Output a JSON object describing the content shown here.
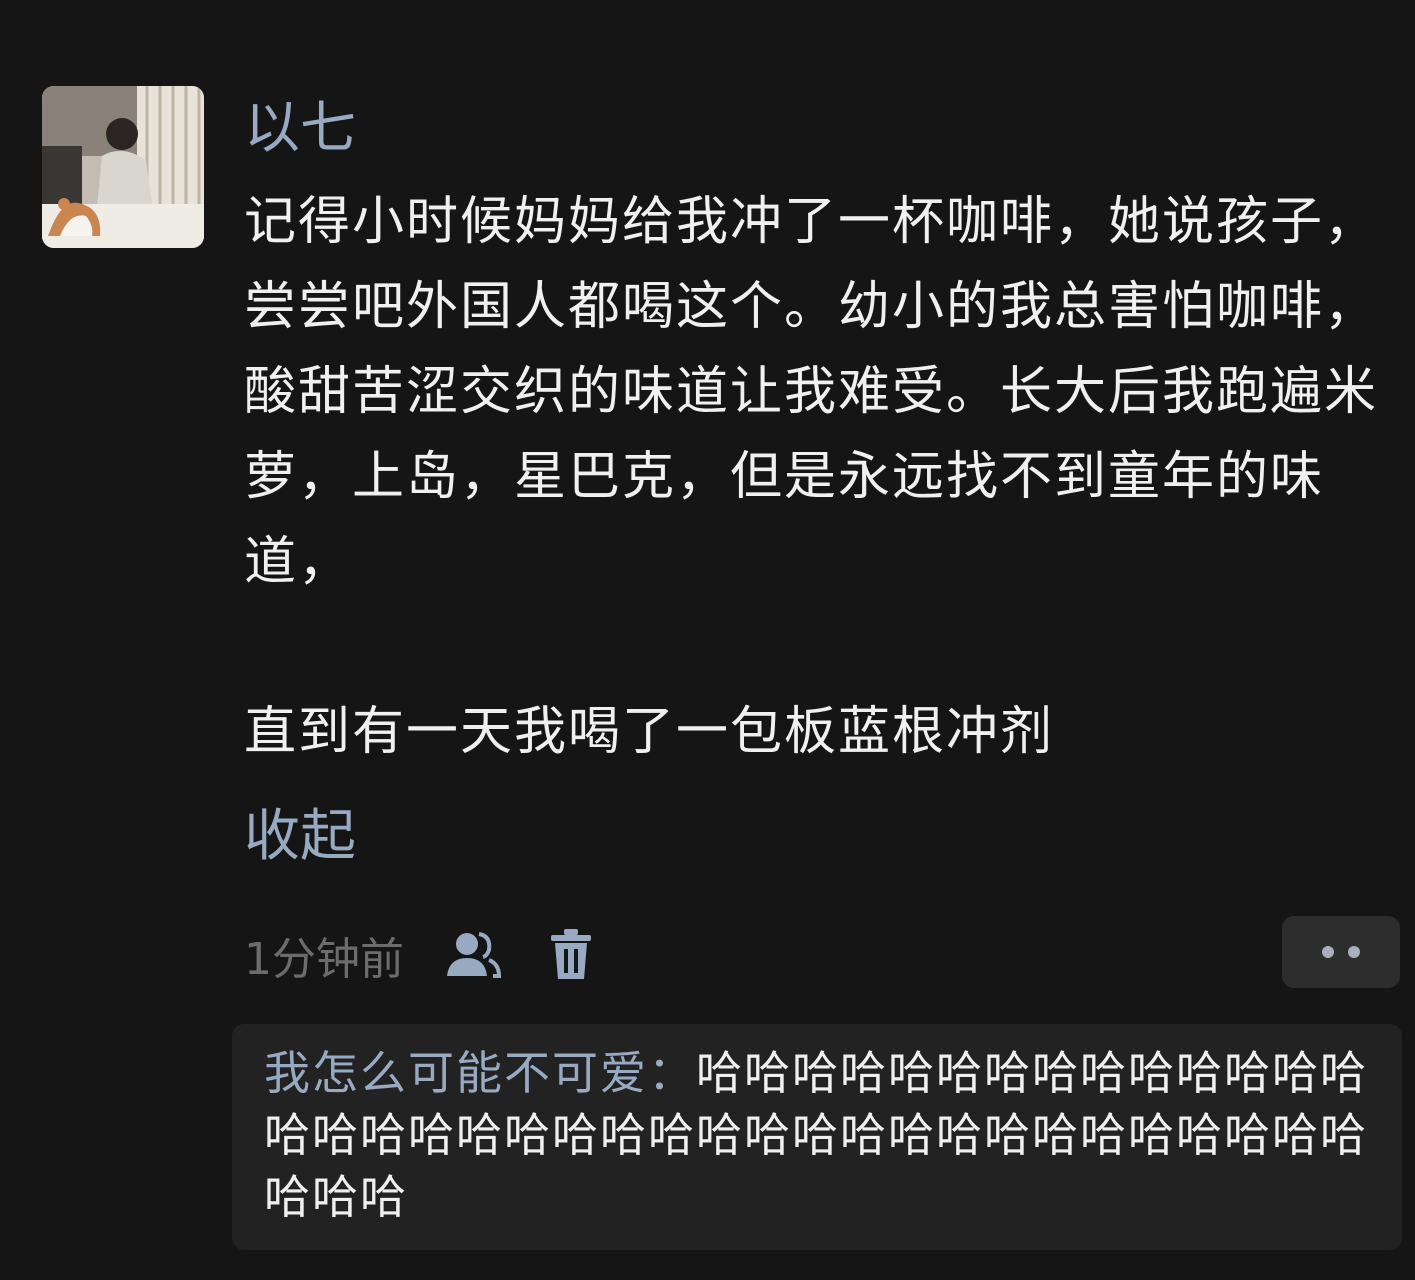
{
  "comment": {
    "author": "以七",
    "paragraphs": [
      "记得小时候妈妈给我冲了一杯咖啡，她说孩子，尝尝吧外国人都喝这个。幼小的我总害怕咖啡，酸甜苦涩交织的味道让我难受。长大后我跑遍米萝，上岛，星巴克，但是永远找不到童年的味道，",
      "直到有一天我喝了一包板蓝根冲剂"
    ],
    "collapse_label": "收起",
    "timestamp": "1分钟前"
  },
  "actions": {
    "people_icon": "people-icon",
    "trash_icon": "trash-icon",
    "more_icon": "more-dots-icon"
  },
  "reply": {
    "author": "我怎么可能不可爱",
    "separator": "：",
    "text": "哈哈哈哈哈哈哈哈哈哈哈哈哈哈哈哈哈哈哈哈哈哈哈哈哈哈哈哈哈哈哈哈哈哈哈哈哈哈哈哈"
  },
  "colors": {
    "background": "#151515",
    "link_blue": "#98a9c2",
    "reply_bg": "#222222"
  }
}
